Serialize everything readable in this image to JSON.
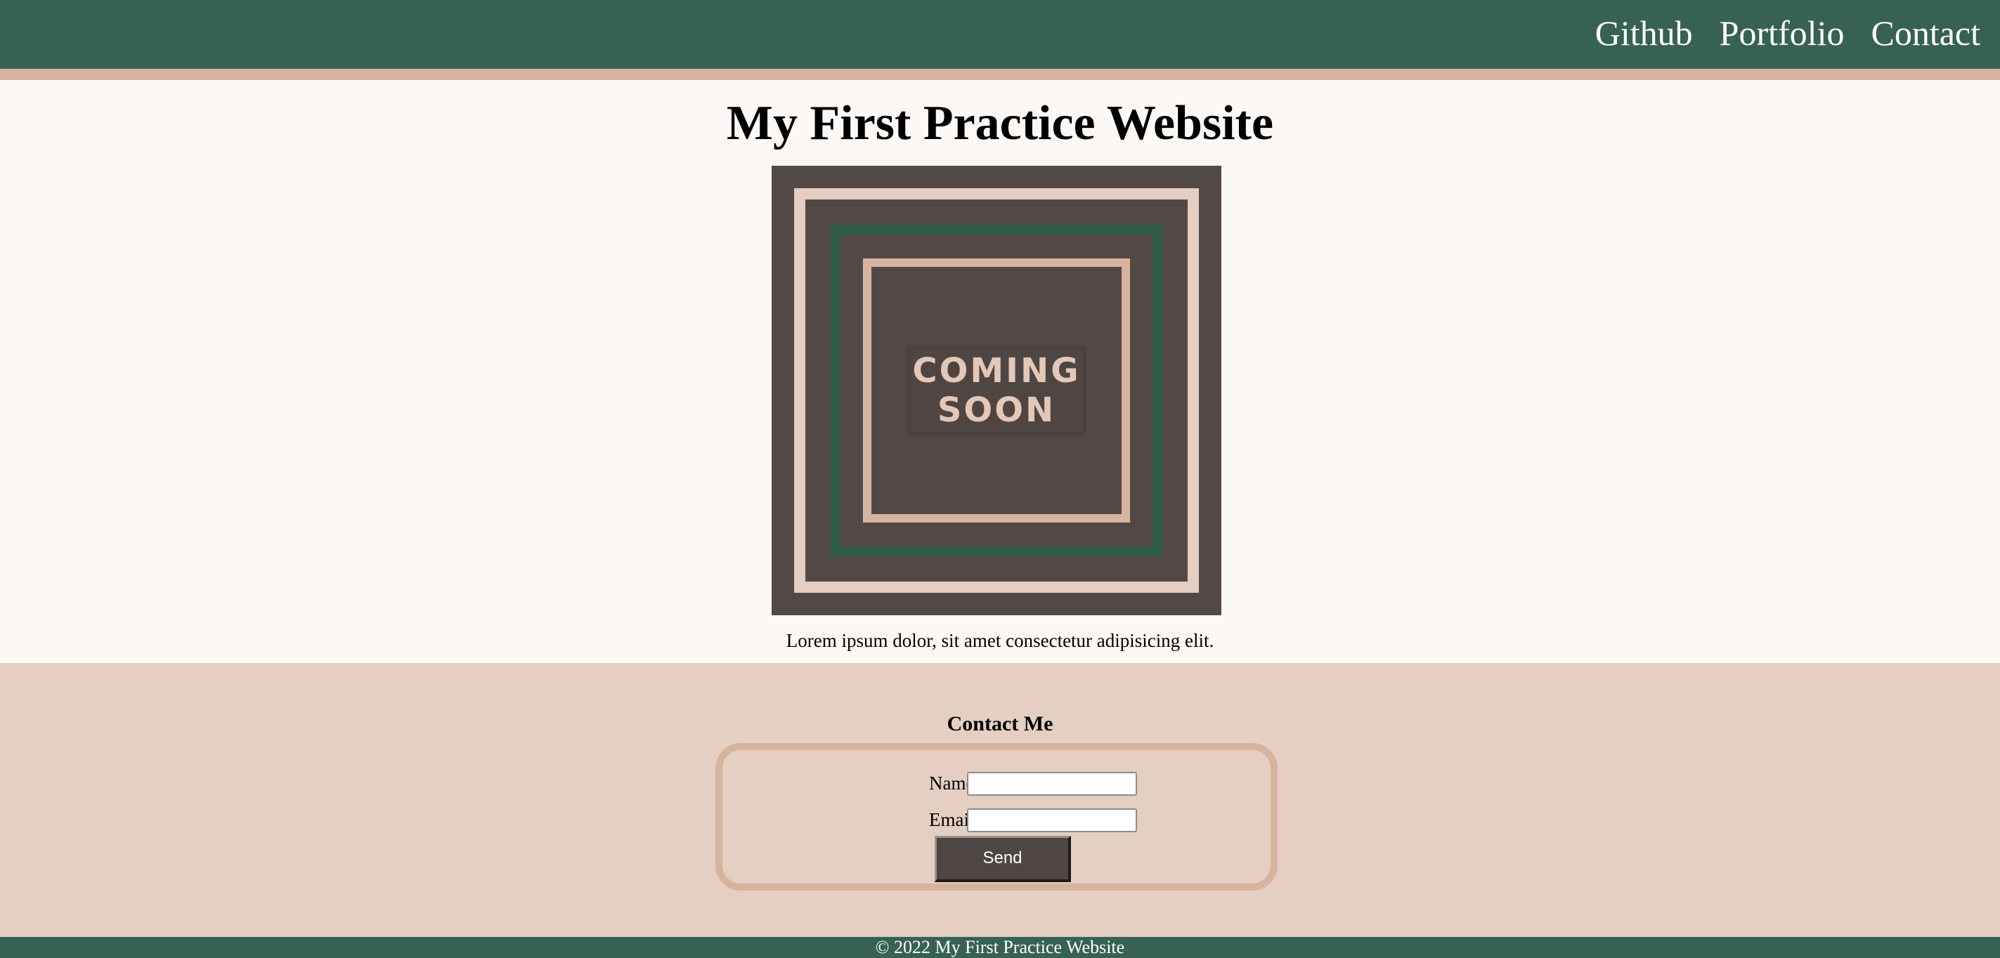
{
  "header": {
    "nav": [
      {
        "label": "Github"
      },
      {
        "label": "Portfolio"
      },
      {
        "label": "Contact"
      }
    ]
  },
  "main": {
    "title": "My First Practice Website",
    "image": {
      "text_line_1": "COMING",
      "text_line_2": "SOON"
    },
    "caption": "Lorem ipsum dolor, sit amet consectetur adipisicing elit."
  },
  "contact": {
    "title": "Contact Me",
    "name_label": "Name:",
    "name_value": "",
    "email_label": "Email:",
    "email_value": "",
    "send_label": "Send"
  },
  "footer": {
    "text": "© 2022 My First Practice Website"
  },
  "colors": {
    "header_bg": "#376253",
    "accent": "#d8b4a0",
    "page_bg": "#fcf8f5",
    "contact_bg": "#e4cfc2",
    "button_bg": "#4d4644"
  }
}
